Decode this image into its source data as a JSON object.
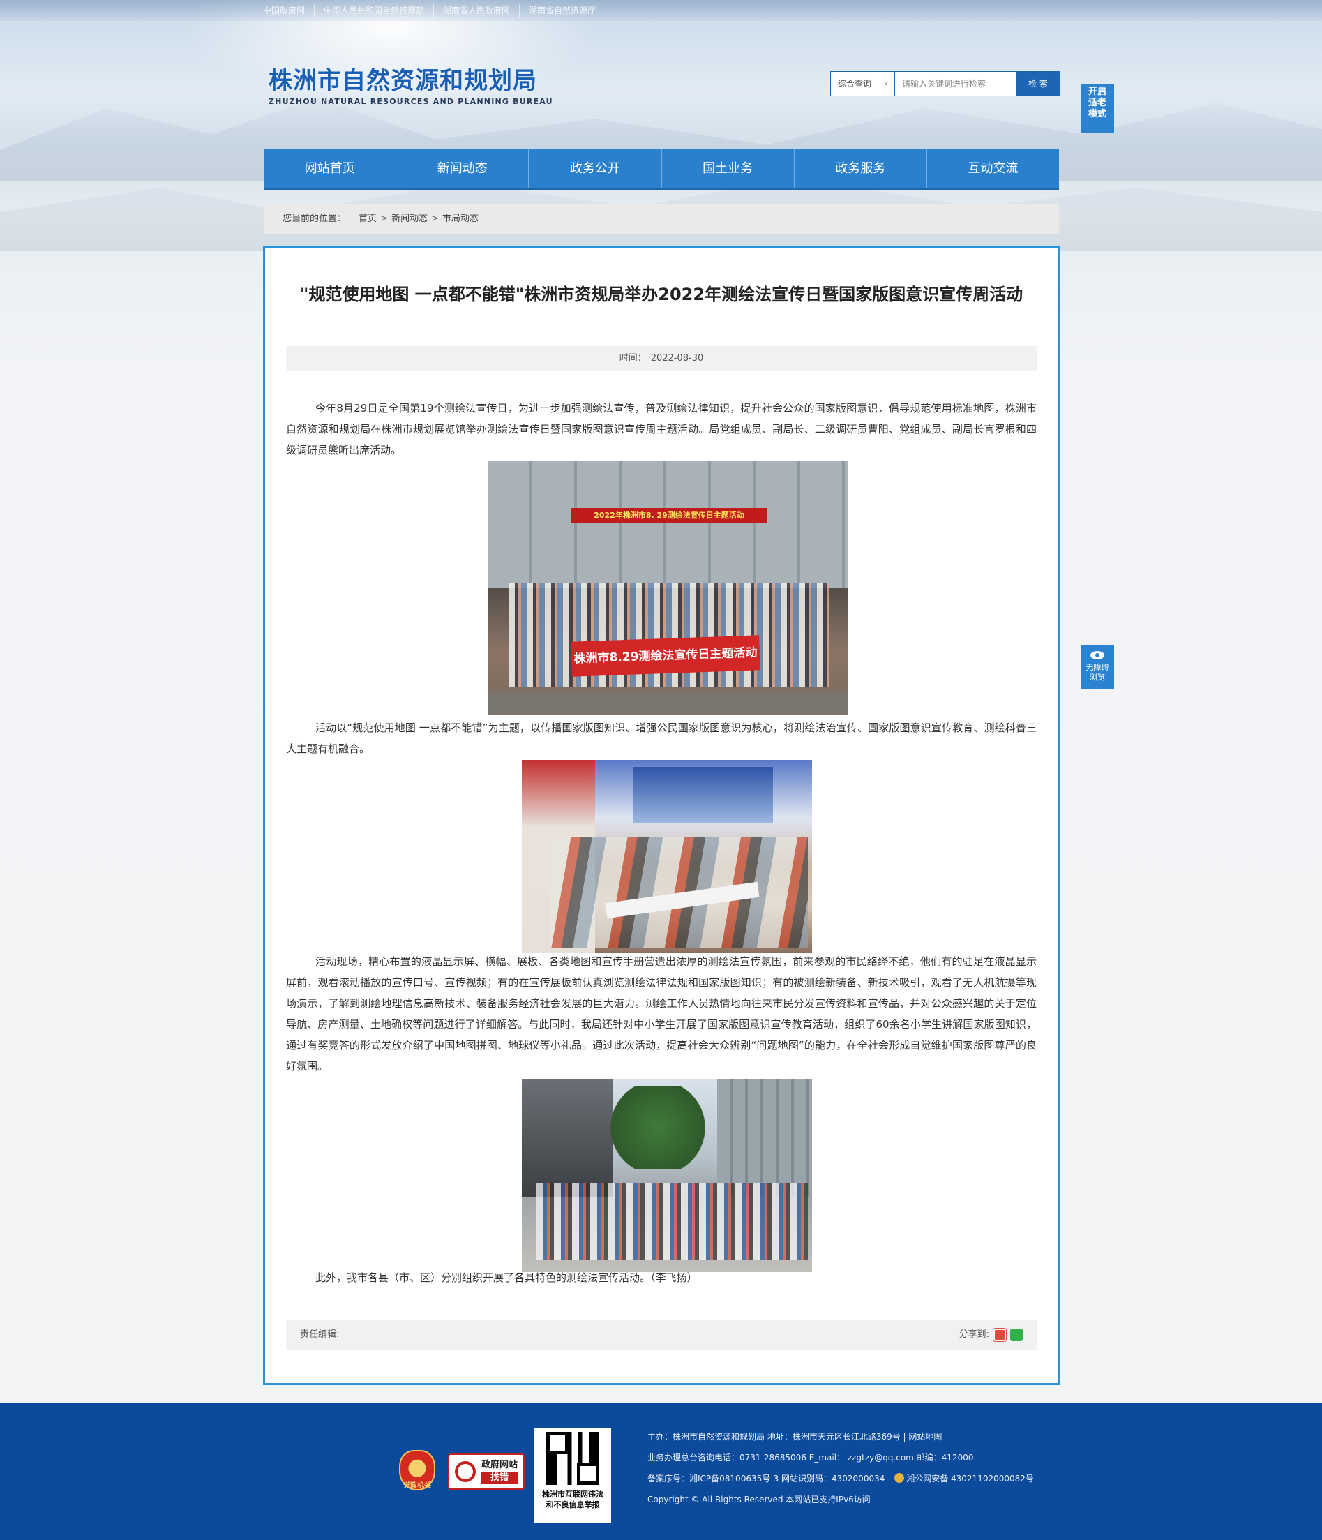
{
  "top_links": [
    "中国政府网",
    "中华人民共和国自然资源部",
    "湖南省人民政府网",
    "湖南省自然资源厅"
  ],
  "logo": {
    "cn": "株洲市自然资源和规划局",
    "en": "ZHUZHOU NATURAL RESOURCES AND PLANNING BUREAU"
  },
  "search": {
    "scope": "综合查询",
    "placeholder": "请输入关键词进行检索",
    "button": "检 索"
  },
  "elder_mode": [
    "开启",
    "适老",
    "模式"
  ],
  "nav": [
    "网站首页",
    "新闻动态",
    "政务公开",
    "国土业务",
    "政务服务",
    "互动交流"
  ],
  "breadcrumb": {
    "label": "您当前的位置：",
    "items": [
      "首页",
      "新闻动态",
      "市局动态"
    ]
  },
  "accessibility": [
    "无障碍",
    "浏览"
  ],
  "article": {
    "title": "\"规范使用地图 一点都不能错\"株洲市资规局举办2022年测绘法宣传日暨国家版图意识宣传周活动",
    "time_label": "时间：",
    "time": "2022-08-30",
    "p1": "今年8月29日是全国第19个测绘法宣传日，为进一步加强测绘法宣传，普及测绘法律知识，提升社会公众的国家版图意识，倡导规范使用标准地图，株洲市自然资源和规划局在株洲市规划展览馆举办测绘法宣传日暨国家版图意识宣传周主题活动。局党组成员、副局长、二级调研员曹阳、党组成员、副局长言罗根和四级调研员熊昕出席活动。",
    "photo1_banner_top": "2022年株洲市8. 29测绘法宣传日主题活动",
    "photo1_banner_main": "株洲市8.29测绘法宣传日主题活动",
    "p2": "活动以“规范使用地图 一点都不能错”为主题，以传播国家版图知识、增强公民国家版图意识为核心，将测绘法治宣传、国家版图意识宣传教育、测绘科普三大主题有机融合。",
    "p3": "活动现场，精心布置的液晶显示屏、横幅、展板、各类地图和宣传手册营造出浓厚的测绘法宣传氛围，前来参观的市民络绎不绝，他们有的驻足在液晶显示屏前，观看滚动播放的宣传口号、宣传视频；有的在宣传展板前认真浏览测绘法律法规和国家版图知识；有的被测绘新装备、新技术吸引，观看了无人机航摄等现场演示，了解到测绘地理信息高新技术、装备服务经济社会发展的巨大潜力。测绘工作人员热情地向往来市民分发宣传资料和宣传品，并对公众感兴趣的关于定位导航、房产测量、土地确权等问题进行了详细解答。与此同时，我局还针对中小学生开展了国家版图意识宣传教育活动，组织了60余名小学生讲解国家版图知识，通过有奖竞答的形式发放介绍了中国地图拼图、地球仪等小礼品。通过此次活动，提高社会大众辨别“问题地图”的能力，在全社会形成自觉维护国家版图尊严的良好氛围。",
    "p4": "此外，我市各县（市、区）分别组织开展了各具特色的测绘法宣传活动。（李飞扬）",
    "editor_label": "责任编辑:",
    "share_label": "分享到:"
  },
  "footer": {
    "emblem_text": "党政机关",
    "gov_find_line1": "政府网站",
    "gov_find_line2": "找错",
    "qr_caption_1": "株洲市互联网违法",
    "qr_caption_2": "和不良信息举报",
    "line1": "主办：株洲市自然资源和规划局   地址：株洲市天元区长江北路369号  |  网站地图",
    "line2": "业务办理总台咨询电话：0731-28685006    E_mail：  zzgtzy@qq.com     邮编：412000",
    "line3a": "备案序号：湘ICP备08100635号-3  网站识别码：4302000034",
    "line3b": "湘公网安备 43021102000082号",
    "line4": "Copyright © All Rights Reserved 本网站已支持IPv6访问"
  }
}
